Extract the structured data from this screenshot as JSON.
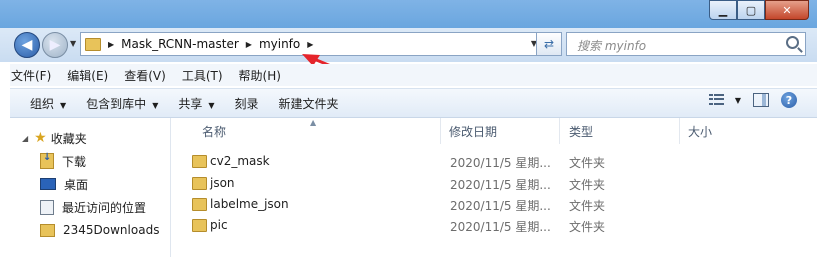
{
  "window": {
    "controls": {
      "minimize": "▁",
      "maximize": "▢",
      "close": "✕"
    }
  },
  "address": {
    "breadcrumbs": [
      "Mask_RCNN-master",
      "myinfo"
    ],
    "search_placeholder": "搜索 myinfo"
  },
  "menu": [
    "文件(F)",
    "编辑(E)",
    "查看(V)",
    "工具(T)",
    "帮助(H)"
  ],
  "toolbar": {
    "organize": "组织",
    "include_in_library": "包含到库中",
    "share": "共享",
    "burn": "刻录",
    "new_folder": "新建文件夹"
  },
  "sidebar": {
    "favorites": "收藏夹",
    "items": [
      "下载",
      "桌面",
      "最近访问的位置",
      "2345Downloads"
    ]
  },
  "columns": {
    "name": "名称",
    "modified": "修改日期",
    "type": "类型",
    "size": "大小"
  },
  "files": [
    {
      "name": "cv2_mask",
      "modified": "2020/11/5 星期...",
      "type": "文件夹"
    },
    {
      "name": "json",
      "modified": "2020/11/5 星期...",
      "type": "文件夹"
    },
    {
      "name": "labelme_json",
      "modified": "2020/11/5 星期...",
      "type": "文件夹"
    },
    {
      "name": "pic",
      "modified": "2020/11/5 星期...",
      "type": "文件夹"
    }
  ],
  "colors": {
    "annotation_arrow": "#e5242b",
    "accent": "#2c5ea8"
  }
}
